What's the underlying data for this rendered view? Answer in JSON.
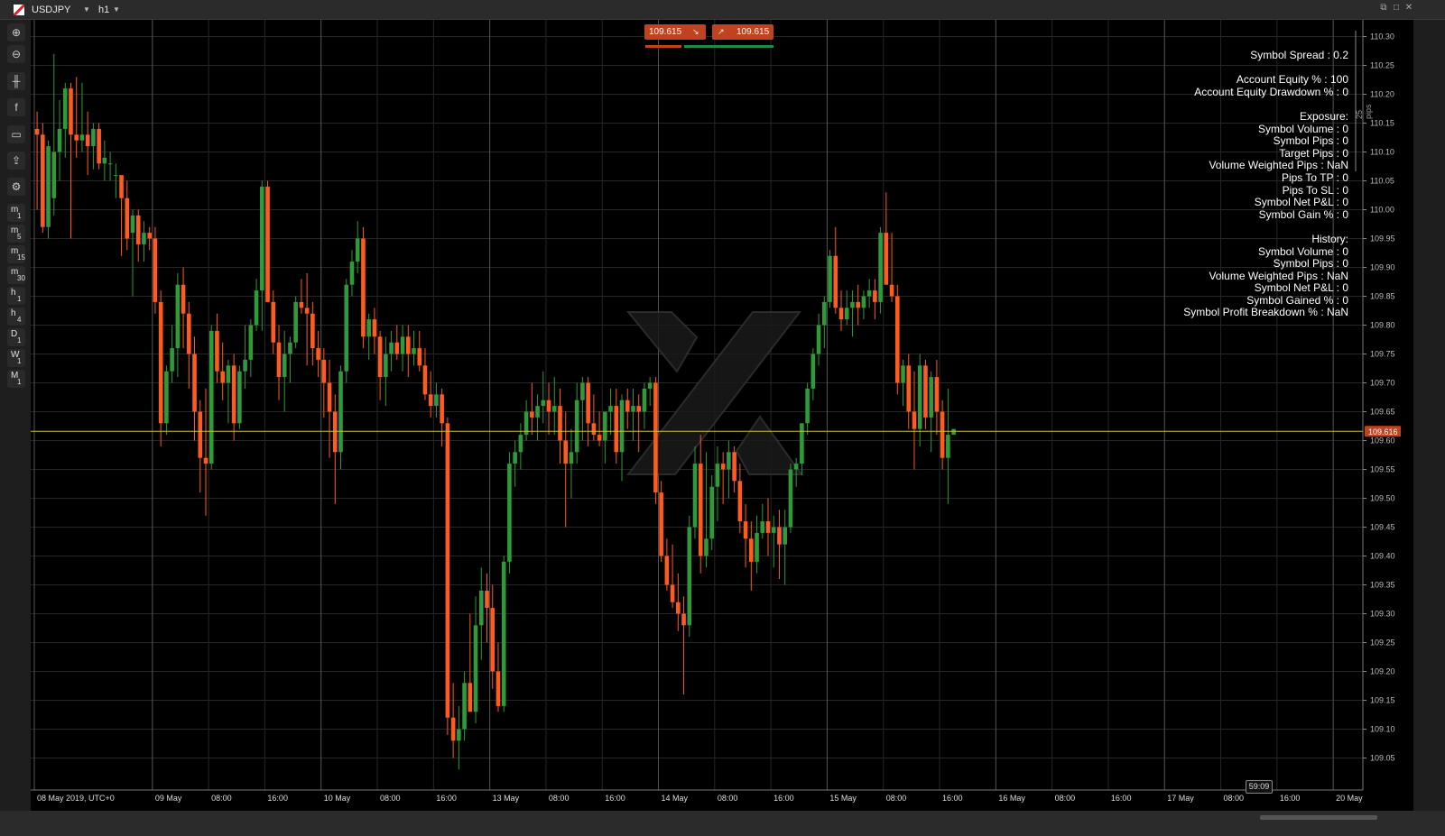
{
  "header": {
    "symbol": "USDJPY",
    "timeframe": "h1"
  },
  "quotes": {
    "sell_price": "109.615",
    "buy_price": "109.615"
  },
  "toolbar": {
    "items": [
      {
        "icon": "zoom-in-icon"
      },
      {
        "icon": "zoom-out-icon"
      },
      {
        "icon": "chart-type-icon"
      },
      {
        "icon": "facebook-icon"
      },
      {
        "icon": "templates-icon"
      },
      {
        "icon": "share-icon"
      },
      {
        "icon": "settings-icon"
      }
    ],
    "timeframes": [
      {
        "a": "m",
        "b": "1"
      },
      {
        "a": "m",
        "b": "5"
      },
      {
        "a": "m",
        "b": "15"
      },
      {
        "a": "m",
        "b": "30"
      },
      {
        "a": "h",
        "b": "1"
      },
      {
        "a": "h",
        "b": "4"
      },
      {
        "a": "D",
        "b": "1"
      },
      {
        "a": "W",
        "b": "1"
      },
      {
        "a": "M",
        "b": "1"
      }
    ]
  },
  "info_panel": {
    "lines": [
      "Symbol Spread : 0.2",
      "",
      "Account Equity % : 100",
      "Account Equity Drawdown % : 0",
      "",
      "Exposure:",
      "Symbol Volume : 0",
      "Symbol Pips : 0",
      "Target Pips : 0",
      "Volume Weighted Pips : NaN",
      "Pips To TP : 0",
      "Pips To SL : 0",
      "Symbol Net P&L : 0",
      "Symbol Gain % : 0",
      "",
      "History:",
      "Symbol Volume : 0",
      "Symbol Pips : 0",
      "Volume Weighted Pips : NaN",
      "Symbol Net P&L : 0",
      "Symbol Gained % : 0",
      "Symbol Profit Breakdown % : NaN"
    ]
  },
  "pips_label": "25 pips",
  "bar_timer": "59:09",
  "colors": {
    "bull": "#2e9a3a",
    "bear": "#ff5a1f",
    "price_line": "#c9c23a",
    "price_tag": "#c0421f"
  },
  "chart_data": {
    "type": "candlestick",
    "current_price": 109.616,
    "current_price_label": "109.616",
    "ylim": [
      109.02,
      110.32
    ],
    "y_ticks": [
      110.3,
      110.25,
      110.2,
      110.15,
      110.1,
      110.05,
      110.0,
      109.95,
      109.9,
      109.85,
      109.8,
      109.75,
      109.7,
      109.65,
      109.6,
      109.55,
      109.5,
      109.45,
      109.4,
      109.35,
      109.3,
      109.25,
      109.2,
      109.15,
      109.1,
      109.05
    ],
    "y_tick_labels": [
      "110.30",
      "110.25",
      "110.20",
      "110.15",
      "110.10",
      "110.05",
      "110.00",
      "109.95",
      "109.90",
      "109.85",
      "109.80",
      "109.75",
      "109.70",
      "109.65",
      "109.60",
      "109.55",
      "109.50",
      "109.45",
      "109.40",
      "109.35",
      "109.30",
      "109.25",
      "109.20",
      "109.15",
      "109.10",
      "109.05"
    ],
    "x_labels": [
      "08 May 2019, UTC+0",
      "09 May",
      "08:00",
      "16:00",
      "10 May",
      "08:00",
      "16:00",
      "13 May",
      "08:00",
      "16:00",
      "14 May",
      "08:00",
      "16:00",
      "15 May",
      "08:00",
      "16:00",
      "16 May",
      "08:00",
      "16:00",
      "17 May",
      "08:00",
      "16:00",
      "20 May"
    ],
    "x_label_positions": [
      0,
      21,
      31,
      41,
      51,
      61,
      71,
      81,
      91,
      101,
      111,
      121,
      131,
      141,
      151,
      161,
      171,
      181,
      191,
      201,
      211,
      221,
      231
    ],
    "gridlines_at_labels": true,
    "candles": [
      [
        110.14,
        110.17,
        110.0,
        110.13
      ],
      [
        110.13,
        110.15,
        109.96,
        109.97
      ],
      [
        109.97,
        110.12,
        109.95,
        110.11
      ],
      [
        110.02,
        110.27,
        109.99,
        110.1
      ],
      [
        110.1,
        110.19,
        110.05,
        110.14
      ],
      [
        110.14,
        110.22,
        110.09,
        110.21
      ],
      [
        110.21,
        110.22,
        109.95,
        110.13
      ],
      [
        110.13,
        110.23,
        110.09,
        110.12
      ],
      [
        110.12,
        110.22,
        110.1,
        110.13
      ],
      [
        110.13,
        110.17,
        110.06,
        110.11
      ],
      [
        110.11,
        110.15,
        110.07,
        110.14
      ],
      [
        110.14,
        110.15,
        110.07,
        110.08
      ],
      [
        110.08,
        110.12,
        110.05,
        110.09
      ],
      [
        110.08,
        110.1,
        110.05,
        110.08
      ],
      [
        110.06,
        110.08,
        110.02,
        110.06
      ],
      [
        110.06,
        110.04,
        109.92,
        110.02
      ],
      [
        110.02,
        110.05,
        109.93,
        109.95
      ],
      [
        109.96,
        110.0,
        109.85,
        109.99
      ],
      [
        109.99,
        110.0,
        109.91,
        109.94
      ],
      [
        109.94,
        109.98,
        109.91,
        109.96
      ],
      [
        109.96,
        109.97,
        109.93,
        109.95
      ],
      [
        109.95,
        109.97,
        109.82,
        109.84
      ],
      [
        109.84,
        109.86,
        109.59,
        109.63
      ],
      [
        109.63,
        109.73,
        109.61,
        109.72
      ],
      [
        109.72,
        109.8,
        109.7,
        109.76
      ],
      [
        109.76,
        109.89,
        109.71,
        109.87
      ],
      [
        109.87,
        109.9,
        109.76,
        109.82
      ],
      [
        109.82,
        109.84,
        109.69,
        109.75
      ],
      [
        109.75,
        109.78,
        109.6,
        109.65
      ],
      [
        109.65,
        109.67,
        109.51,
        109.57
      ],
      [
        109.57,
        109.69,
        109.47,
        109.56
      ],
      [
        109.56,
        109.8,
        109.55,
        109.79
      ],
      [
        109.79,
        109.82,
        109.7,
        109.72
      ],
      [
        109.72,
        109.77,
        109.67,
        109.7
      ],
      [
        109.7,
        109.74,
        109.63,
        109.73
      ],
      [
        109.73,
        109.75,
        109.6,
        109.63
      ],
      [
        109.63,
        109.73,
        109.62,
        109.72
      ],
      [
        109.72,
        109.8,
        109.69,
        109.74
      ],
      [
        109.74,
        109.81,
        109.71,
        109.8
      ],
      [
        109.8,
        109.88,
        109.79,
        109.86
      ],
      [
        109.86,
        110.05,
        109.79,
        110.04
      ],
      [
        110.04,
        110.05,
        109.84,
        109.84
      ],
      [
        109.84,
        109.86,
        109.75,
        109.77
      ],
      [
        109.77,
        109.8,
        109.67,
        109.71
      ],
      [
        109.71,
        109.79,
        109.65,
        109.75
      ],
      [
        109.75,
        109.78,
        109.7,
        109.77
      ],
      [
        109.77,
        109.85,
        109.76,
        109.84
      ],
      [
        109.84,
        109.88,
        109.82,
        109.83
      ],
      [
        109.83,
        109.89,
        109.73,
        109.82
      ],
      [
        109.82,
        109.84,
        109.73,
        109.76
      ],
      [
        109.76,
        109.79,
        109.71,
        109.74
      ],
      [
        109.74,
        109.76,
        109.64,
        109.7
      ],
      [
        109.7,
        109.74,
        109.57,
        109.65
      ],
      [
        109.65,
        109.68,
        109.49,
        109.58
      ],
      [
        109.58,
        109.73,
        109.55,
        109.72
      ],
      [
        109.72,
        109.88,
        109.7,
        109.87
      ],
      [
        109.87,
        109.93,
        109.85,
        109.91
      ],
      [
        109.91,
        109.98,
        109.89,
        109.95
      ],
      [
        109.95,
        109.97,
        109.76,
        109.78
      ],
      [
        109.78,
        109.82,
        109.74,
        109.81
      ],
      [
        109.81,
        109.83,
        109.75,
        109.78
      ],
      [
        109.78,
        109.79,
        109.67,
        109.71
      ],
      [
        109.71,
        109.78,
        109.66,
        109.75
      ],
      [
        109.75,
        109.79,
        109.72,
        109.77
      ],
      [
        109.77,
        109.8,
        109.74,
        109.75
      ],
      [
        109.75,
        109.8,
        109.72,
        109.78
      ],
      [
        109.78,
        109.8,
        109.71,
        109.75
      ],
      [
        109.75,
        109.79,
        109.73,
        109.76
      ],
      [
        109.76,
        109.79,
        109.72,
        109.73
      ],
      [
        109.73,
        109.76,
        109.67,
        109.68
      ],
      [
        109.68,
        109.72,
        109.64,
        109.66
      ],
      [
        109.66,
        109.7,
        109.64,
        109.68
      ],
      [
        109.68,
        109.69,
        109.59,
        109.63
      ],
      [
        109.63,
        109.64,
        109.09,
        109.12
      ],
      [
        109.12,
        109.18,
        109.05,
        109.08
      ],
      [
        109.08,
        109.14,
        109.03,
        109.1
      ],
      [
        109.1,
        109.2,
        109.08,
        109.18
      ],
      [
        109.18,
        109.3,
        109.14,
        109.13
      ],
      [
        109.13,
        109.33,
        109.11,
        109.28
      ],
      [
        109.28,
        109.38,
        109.22,
        109.34
      ],
      [
        109.34,
        109.37,
        109.25,
        109.31
      ],
      [
        109.31,
        109.35,
        109.17,
        109.2
      ],
      [
        109.2,
        109.25,
        109.13,
        109.14
      ],
      [
        109.14,
        109.4,
        109.13,
        109.39
      ],
      [
        109.39,
        109.58,
        109.37,
        109.56
      ],
      [
        109.56,
        109.6,
        109.52,
        109.58
      ],
      [
        109.58,
        109.63,
        109.55,
        109.61
      ],
      [
        109.61,
        109.67,
        109.6,
        109.65
      ],
      [
        109.65,
        109.7,
        109.61,
        109.64
      ],
      [
        109.64,
        109.68,
        109.6,
        109.66
      ],
      [
        109.66,
        109.72,
        109.63,
        109.67
      ],
      [
        109.67,
        109.7,
        109.61,
        109.65
      ],
      [
        109.65,
        109.71,
        109.61,
        109.66
      ],
      [
        109.66,
        109.69,
        109.56,
        109.6
      ],
      [
        109.6,
        109.65,
        109.45,
        109.56
      ],
      [
        109.56,
        109.62,
        109.5,
        109.58
      ],
      [
        109.58,
        109.7,
        109.56,
        109.67
      ],
      [
        109.67,
        109.71,
        109.6,
        109.7
      ],
      [
        109.7,
        109.71,
        109.59,
        109.63
      ],
      [
        109.63,
        109.68,
        109.6,
        109.61
      ],
      [
        109.61,
        109.65,
        109.59,
        109.6
      ],
      [
        109.6,
        109.65,
        109.56,
        109.65
      ],
      [
        109.65,
        109.69,
        109.61,
        109.66
      ],
      [
        109.66,
        109.69,
        109.56,
        109.58
      ],
      [
        109.58,
        109.68,
        109.53,
        109.67
      ],
      [
        109.67,
        109.69,
        109.62,
        109.65
      ],
      [
        109.65,
        109.69,
        109.6,
        109.66
      ],
      [
        109.66,
        109.68,
        109.58,
        109.65
      ],
      [
        109.65,
        109.7,
        109.62,
        109.69
      ],
      [
        109.69,
        109.71,
        109.66,
        109.7
      ],
      [
        109.7,
        109.71,
        109.49,
        109.51
      ],
      [
        109.51,
        109.53,
        109.39,
        109.4
      ],
      [
        109.4,
        109.43,
        109.34,
        109.35
      ],
      [
        109.35,
        109.42,
        109.31,
        109.32
      ],
      [
        109.32,
        109.37,
        109.27,
        109.3
      ],
      [
        109.3,
        109.33,
        109.16,
        109.28
      ],
      [
        109.28,
        109.47,
        109.26,
        109.45
      ],
      [
        109.45,
        109.59,
        109.43,
        109.56
      ],
      [
        109.56,
        109.61,
        109.37,
        109.4
      ],
      [
        109.4,
        109.58,
        109.38,
        109.43
      ],
      [
        109.43,
        109.54,
        109.41,
        109.52
      ],
      [
        109.52,
        109.59,
        109.46,
        109.56
      ],
      [
        109.56,
        109.58,
        109.49,
        109.55
      ],
      [
        109.55,
        109.6,
        109.5,
        109.58
      ],
      [
        109.58,
        109.59,
        109.51,
        109.53
      ],
      [
        109.53,
        109.56,
        109.44,
        109.46
      ],
      [
        109.46,
        109.49,
        109.38,
        109.43
      ],
      [
        109.43,
        109.46,
        109.34,
        109.39
      ],
      [
        109.39,
        109.47,
        109.37,
        109.44
      ],
      [
        109.44,
        109.49,
        109.43,
        109.46
      ],
      [
        109.46,
        109.5,
        109.4,
        109.44
      ],
      [
        109.44,
        109.47,
        109.38,
        109.45
      ],
      [
        109.45,
        109.48,
        109.36,
        109.42
      ],
      [
        109.42,
        109.48,
        109.35,
        109.45
      ],
      [
        109.45,
        109.56,
        109.44,
        109.55
      ],
      [
        109.55,
        109.57,
        109.52,
        109.56
      ],
      [
        109.56,
        109.63,
        109.54,
        109.63
      ],
      [
        109.63,
        109.7,
        109.61,
        109.69
      ],
      [
        109.69,
        109.76,
        109.67,
        109.75
      ],
      [
        109.75,
        109.82,
        109.73,
        109.8
      ],
      [
        109.8,
        109.85,
        109.76,
        109.84
      ],
      [
        109.84,
        109.93,
        109.83,
        109.92
      ],
      [
        109.92,
        109.97,
        109.82,
        109.83
      ],
      [
        109.83,
        109.86,
        109.79,
        109.81
      ],
      [
        109.81,
        109.86,
        109.8,
        109.83
      ],
      [
        109.83,
        109.86,
        109.78,
        109.84
      ],
      [
        109.84,
        109.87,
        109.8,
        109.83
      ],
      [
        109.83,
        109.86,
        109.81,
        109.85
      ],
      [
        109.85,
        109.88,
        109.83,
        109.86
      ],
      [
        109.86,
        109.88,
        109.81,
        109.84
      ],
      [
        109.84,
        109.97,
        109.82,
        109.96
      ],
      [
        109.96,
        110.03,
        109.92,
        109.87
      ],
      [
        109.87,
        109.96,
        109.84,
        109.85
      ],
      [
        109.85,
        109.87,
        109.68,
        109.7
      ],
      [
        109.7,
        109.74,
        109.66,
        109.73
      ],
      [
        109.73,
        109.75,
        109.62,
        109.65
      ],
      [
        109.65,
        109.72,
        109.55,
        109.62
      ],
      [
        109.62,
        109.75,
        109.59,
        109.73
      ],
      [
        109.73,
        109.74,
        109.62,
        109.64
      ],
      [
        109.64,
        109.72,
        109.58,
        109.71
      ],
      [
        109.71,
        109.74,
        109.61,
        109.65
      ],
      [
        109.65,
        109.67,
        109.55,
        109.57
      ],
      [
        109.57,
        109.69,
        109.49,
        109.61
      ],
      [
        109.61,
        109.62,
        109.61,
        109.62
      ]
    ]
  }
}
